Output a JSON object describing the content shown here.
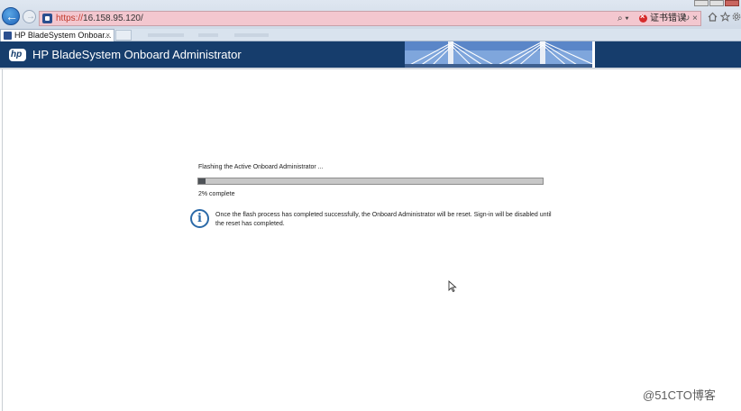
{
  "browser": {
    "url_protocol": "https://",
    "url_host": "16.158.95.120/",
    "search_glyph": "⌕ ▾",
    "cert_error": "证书错误",
    "tab_title": "HP BladeSystem Onboar...",
    "tab_close": "×",
    "refresh_glyph": "↻",
    "close_glyph": "×",
    "back_glyph": "←",
    "forward_glyph": "→",
    "home_icon": "home-icon",
    "favorites_icon": "star-icon",
    "tools_icon": "gear-icon"
  },
  "header": {
    "logo_text": "hp",
    "title": "HP BladeSystem Onboard Administrator"
  },
  "flash": {
    "title": "Flashing the Active Onboard Administrator ...",
    "progress": 0.02,
    "progress_text": "2% complete",
    "info_glyph": "i",
    "info_message": "Once the flash process has completed successfully, the Onboard Administrator will be reset. Sign-in will be disabled until the reset has completed."
  },
  "watermark": "@51CTO博客",
  "colors": {
    "header_bg": "#163d6c",
    "progress_fill": "#4e5257",
    "progress_track": "#c7c7c7",
    "info_blue": "#2b6aa8",
    "address_warning": "#f3c7cf"
  }
}
